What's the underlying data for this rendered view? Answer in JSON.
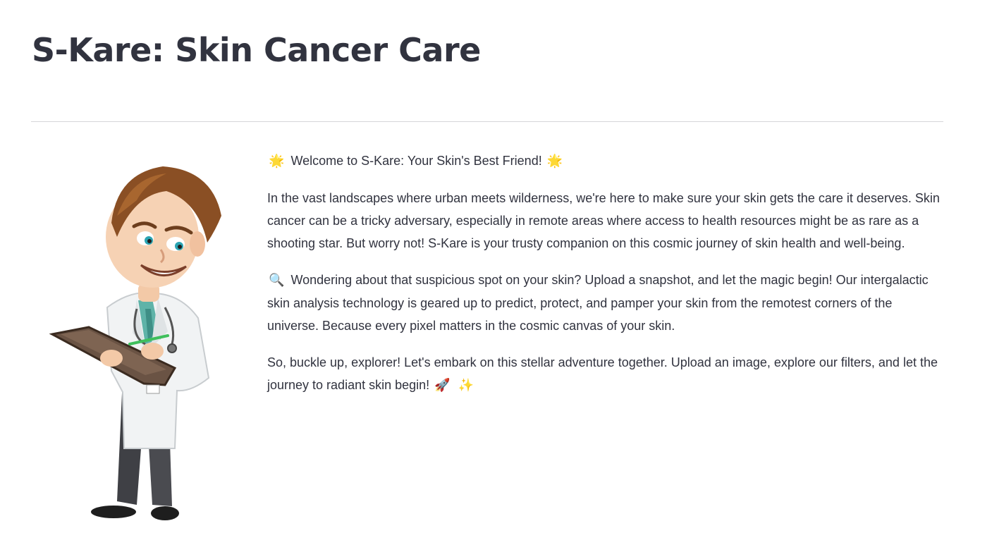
{
  "header": {
    "title": "S-Kare: Skin Cancer Care"
  },
  "illustration": {
    "icon": "doctor-with-clipboard-illustration"
  },
  "intro": {
    "welcome_emoji_left": "🌟",
    "welcome_text": "Welcome to S-Kare: Your Skin's Best Friend!",
    "welcome_emoji_right": "🌟",
    "paragraph_1": "In the vast landscapes where urban meets wilderness, we're here to make sure your skin gets the care it deserves. Skin cancer can be a tricky adversary, especially in remote areas where access to health resources might be as rare as a shooting star. But worry not! S-Kare is your trusty companion on this cosmic journey of skin health and well-being.",
    "paragraph_2_emoji": "🔍",
    "paragraph_2": "Wondering about that suspicious spot on your skin? Upload a snapshot, and let the magic begin! Our intergalactic skin analysis technology is geared up to predict, protect, and pamper your skin from the remotest corners of the universe. Because every pixel matters in the cosmic canvas of your skin.",
    "paragraph_3": "So, buckle up, explorer! Let's embark on this stellar adventure together. Upload an image, explore our filters, and let the journey to radiant skin begin!",
    "paragraph_3_emoji_1": "🚀",
    "paragraph_3_emoji_2": "✨"
  },
  "colors": {
    "text": "#31333f",
    "divider": "#d6d6d9",
    "background": "#ffffff"
  }
}
